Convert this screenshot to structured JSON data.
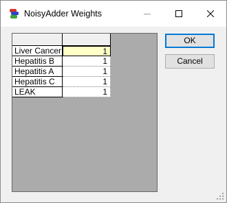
{
  "window": {
    "title": "NoisyAdder Weights"
  },
  "grid": {
    "rows": [
      {
        "label": "Liver Cancer",
        "value": "1"
      },
      {
        "label": "Hepatitis B",
        "value": "1"
      },
      {
        "label": "Hepatitis A",
        "value": "1"
      },
      {
        "label": "Hepatitis C",
        "value": "1"
      },
      {
        "label": "LEAK",
        "value": "1"
      }
    ]
  },
  "buttons": {
    "ok_label": "OK",
    "cancel_label": "Cancel"
  },
  "icons": {
    "app": "noisy-adder-icon",
    "minimize": "minimize-icon",
    "maximize": "maximize-icon",
    "close": "close-icon",
    "grip": "resize-grip-icon"
  },
  "colors": {
    "selected_cell": "#ffffc8",
    "default_button_border": "#0078d7",
    "grid_background": "#ababab"
  }
}
